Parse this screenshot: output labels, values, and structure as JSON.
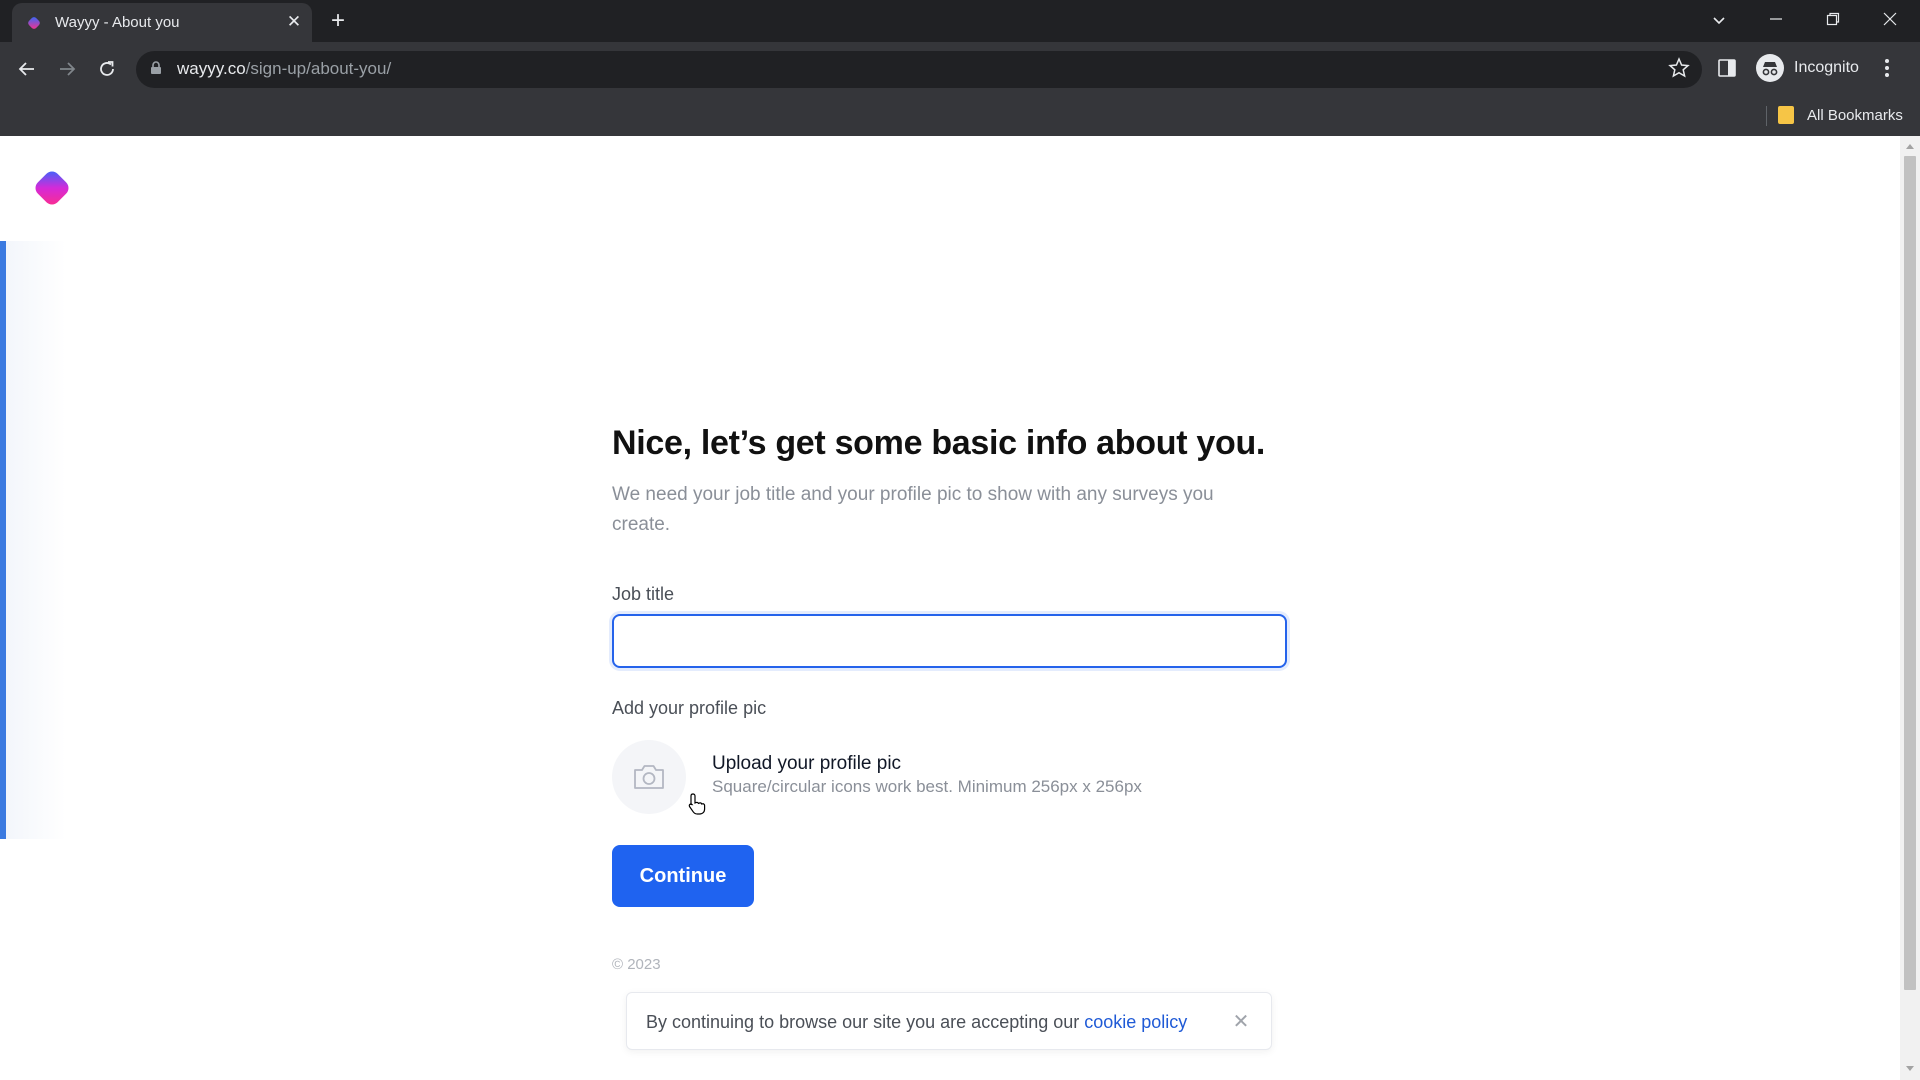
{
  "browser": {
    "tab_title": "Wayyy - About you",
    "tab_close_glyph": "✕",
    "new_tab_glyph": "+",
    "url_host": "wayyy.co",
    "url_path": "/sign-up/about-you/",
    "profile_label": "Incognito",
    "bookmarks_label": "All Bookmarks"
  },
  "page": {
    "heading": "Nice, let’s get some basic info about you.",
    "subtext": "We need your job title and your profile pic to show with any surveys you create.",
    "job_title": {
      "label": "Job title",
      "value": "",
      "placeholder": ""
    },
    "profile_pic": {
      "label": "Add your profile pic",
      "upload_title": "Upload your profile pic",
      "upload_hint": "Square/circular icons work best. Minimum 256px x 256px"
    },
    "continue_label": "Continue",
    "copyright": "© 2023"
  },
  "cookie": {
    "text": "By continuing to browse our site you are accepting our ",
    "link": "cookie policy",
    "close_glyph": "✕"
  },
  "colors": {
    "brand_blue": "#1f63f0",
    "brand_pink": "#ff2d87",
    "link": "#1f5ad6"
  },
  "icons": [
    "back-icon",
    "forward-icon",
    "reload-icon",
    "lock-icon",
    "star-icon",
    "side-panel-icon",
    "incognito-icon",
    "menu-icon",
    "camera-icon",
    "close-icon",
    "folder-icon"
  ]
}
